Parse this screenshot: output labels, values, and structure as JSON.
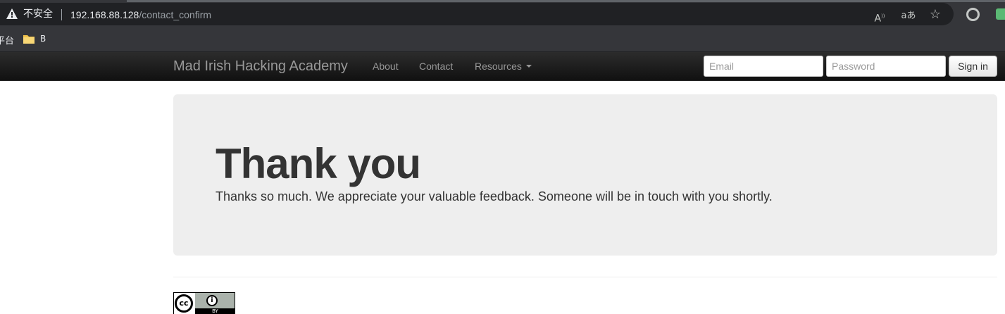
{
  "browser": {
    "security_label": "不安全",
    "url_host": "192.168.88.128",
    "url_path": "/contact_confirm",
    "icons": [
      "warning-icon",
      "read-aloud-icon",
      "translate-icon",
      "favorite-star-icon",
      "profile-icon",
      "extension-icon"
    ],
    "read_aloud_glyph": "A",
    "translate_glyph": "aあ",
    "star_glyph": "☆"
  },
  "bookmarks": {
    "partial_label": "平台",
    "folder_label": "B"
  },
  "navbar": {
    "brand": "Mad Irish Hacking Academy",
    "links": [
      "About",
      "Contact",
      "Resources"
    ],
    "email_placeholder": "Email",
    "password_placeholder": "Password",
    "signin_label": "Sign in"
  },
  "hero": {
    "title": "Thank you",
    "text": "Thanks so much. We appreciate your valuable feedback. Someone will be in touch with you shortly."
  },
  "footer": {
    "license_badge": {
      "cc_mark": "cc",
      "by_icon": "i",
      "label": "BY"
    }
  },
  "colors": {
    "navbar": "#1b1b1b",
    "hero_bg": "#eeeeee",
    "text": "#333333",
    "nav_text": "#999999"
  }
}
